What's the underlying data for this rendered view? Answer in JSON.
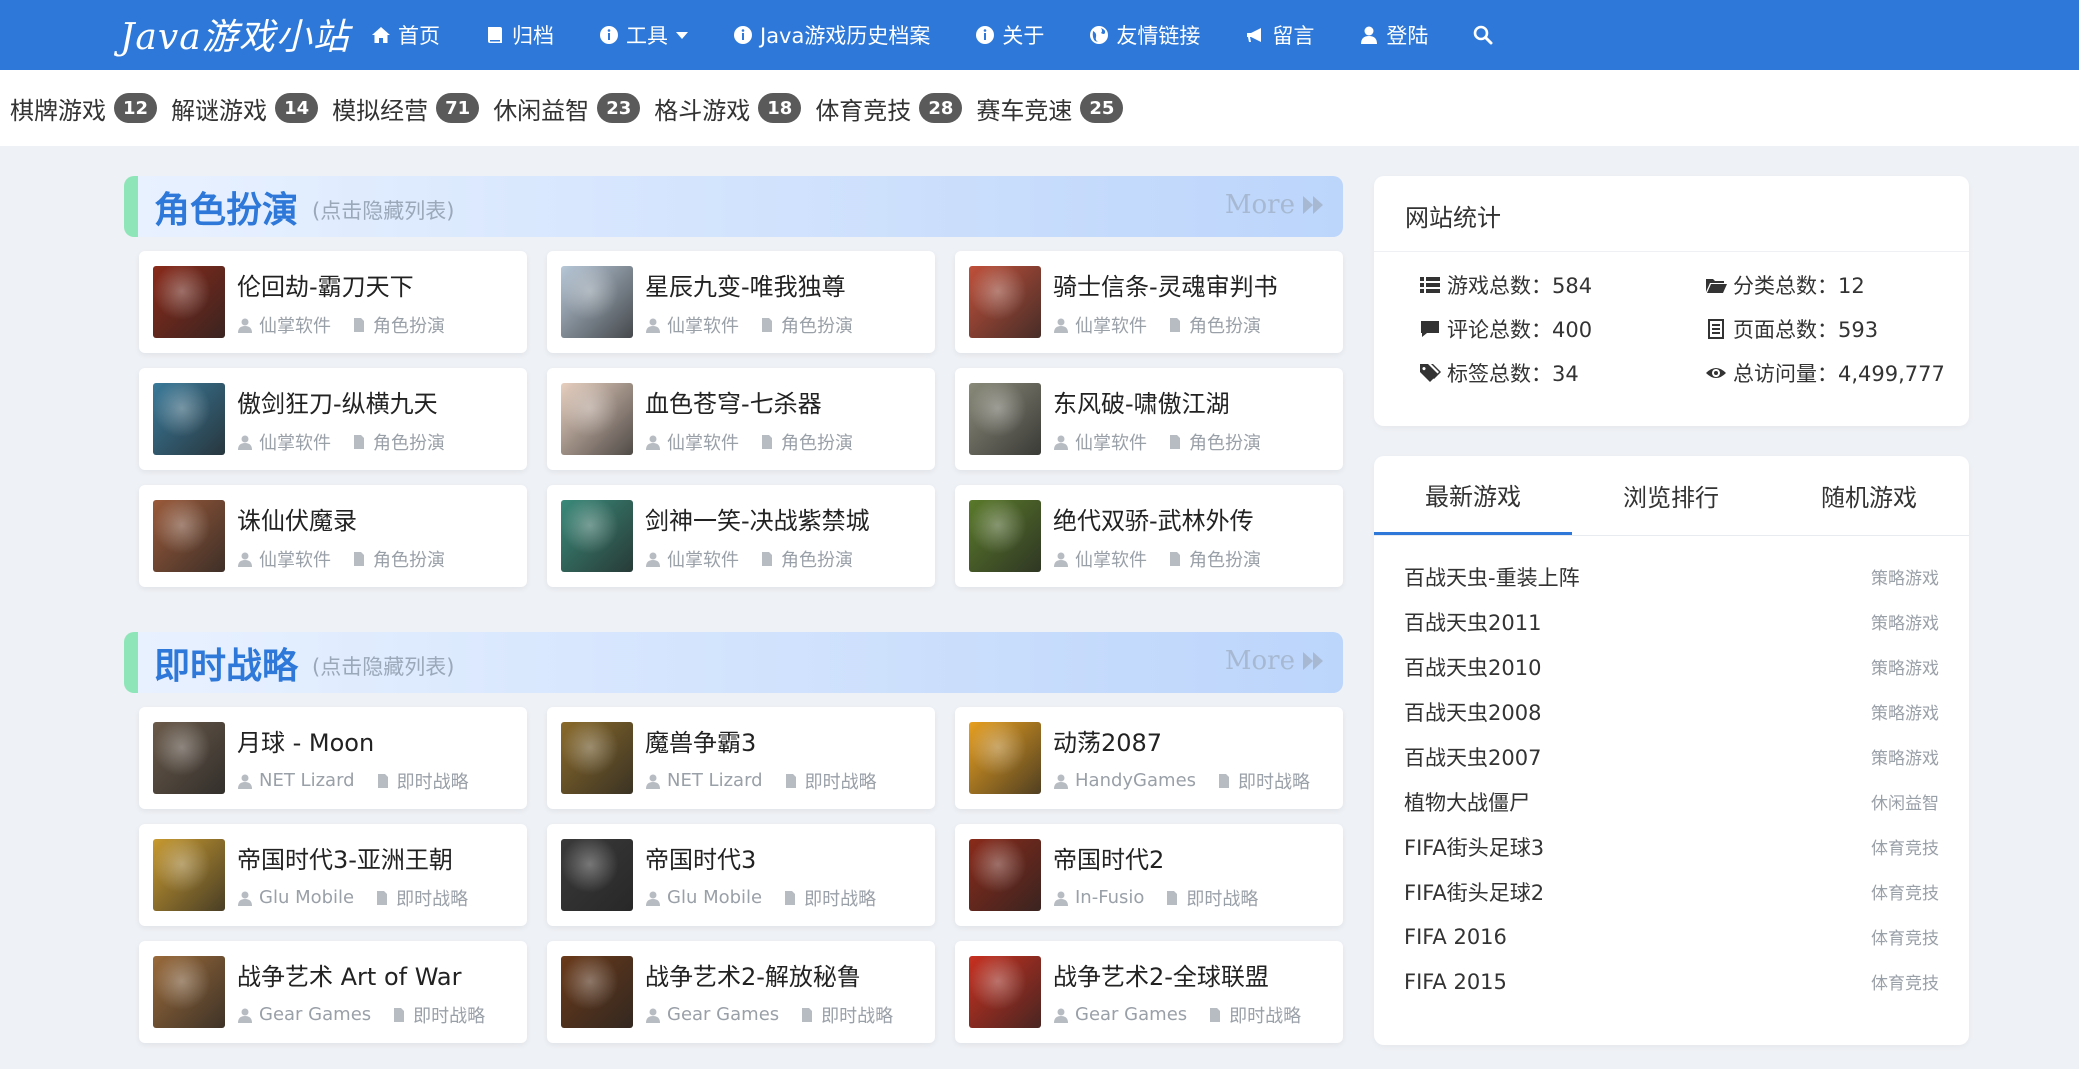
{
  "nav": {
    "brand": "Java游戏小站",
    "items": [
      {
        "label": "首页",
        "icon": "home-icon"
      },
      {
        "label": "归档",
        "icon": "book-icon"
      },
      {
        "label": "工具",
        "icon": "info-icon",
        "dropdown": true
      },
      {
        "label": "Java游戏历史档案",
        "icon": "info-icon"
      },
      {
        "label": "关于",
        "icon": "info-icon"
      },
      {
        "label": "友情链接",
        "icon": "globe-icon"
      },
      {
        "label": "留言",
        "icon": "bullhorn-icon"
      },
      {
        "label": "登陆",
        "icon": "user-icon"
      }
    ],
    "search_icon": "search-icon"
  },
  "categories": [
    {
      "label": "棋牌游戏",
      "count": "12"
    },
    {
      "label": "解谜游戏",
      "count": "14"
    },
    {
      "label": "模拟经营",
      "count": "71"
    },
    {
      "label": "休闲益智",
      "count": "23"
    },
    {
      "label": "格斗游戏",
      "count": "18"
    },
    {
      "label": "体育竞技",
      "count": "28"
    },
    {
      "label": "赛车竞速",
      "count": "25"
    }
  ],
  "sections": [
    {
      "title": "角色扮演",
      "hint": "(点击隐藏列表)",
      "more": "More",
      "games": [
        {
          "title": "伦回劫-霸刀天下",
          "vendor": "仙掌软件",
          "category": "角色扮演",
          "thumb_color": "#8a2a1a"
        },
        {
          "title": "星辰九变-唯我独尊",
          "vendor": "仙掌软件",
          "category": "角色扮演",
          "thumb_color": "#b8c8d8"
        },
        {
          "title": "骑士信条-灵魂审判书",
          "vendor": "仙掌软件",
          "category": "角色扮演",
          "thumb_color": "#c0503a"
        },
        {
          "title": "傲剑狂刀-纵横九天",
          "vendor": "仙掌软件",
          "category": "角色扮演",
          "thumb_color": "#3a7a9a"
        },
        {
          "title": "血色苍穹-七杀器",
          "vendor": "仙掌软件",
          "category": "角色扮演",
          "thumb_color": "#e8d0c0"
        },
        {
          "title": "东风破-啸傲江湖",
          "vendor": "仙掌软件",
          "category": "角色扮演",
          "thumb_color": "#8a8a7a"
        },
        {
          "title": "诛仙伏魔录",
          "vendor": "仙掌软件",
          "category": "角色扮演",
          "thumb_color": "#9a5a3a"
        },
        {
          "title": "剑神一笑-决战紫禁城",
          "vendor": "仙掌软件",
          "category": "角色扮演",
          "thumb_color": "#3a8a7a"
        },
        {
          "title": "绝代双骄-武林外传",
          "vendor": "仙掌软件",
          "category": "角色扮演",
          "thumb_color": "#5a7a2a"
        }
      ]
    },
    {
      "title": "即时战略",
      "hint": "(点击隐藏列表)",
      "more": "More",
      "games": [
        {
          "title": "月球 - Moon",
          "vendor": "NET Lizard",
          "category": "即时战略",
          "thumb_color": "#6a5a4a"
        },
        {
          "title": "魔兽争霸3",
          "vendor": "NET Lizard",
          "category": "即时战略",
          "thumb_color": "#8a6a2a"
        },
        {
          "title": "动荡2087",
          "vendor": "HandyGames",
          "category": "即时战略",
          "thumb_color": "#e8a020"
        },
        {
          "title": "帝国时代3-亚洲王朝",
          "vendor": "Glu Mobile",
          "category": "即时战略",
          "thumb_color": "#c89a30"
        },
        {
          "title": "帝国时代3",
          "vendor": "Glu Mobile",
          "category": "即时战略",
          "thumb_color": "#3a3a3a"
        },
        {
          "title": "帝国时代2",
          "vendor": "In-Fusio",
          "category": "即时战略",
          "thumb_color": "#8a2a1a"
        },
        {
          "title": "战争艺术 Art of War",
          "vendor": "Gear Games",
          "category": "即时战略",
          "thumb_color": "#9a6a3a"
        },
        {
          "title": "战争艺术2-解放秘鲁",
          "vendor": "Gear Games",
          "category": "即时战略",
          "thumb_color": "#6a3a1a"
        },
        {
          "title": "战争艺术2-全球联盟",
          "vendor": "Gear Games",
          "category": "即时战略",
          "thumb_color": "#c83020"
        }
      ]
    }
  ],
  "stats_panel": {
    "title": "网站统计",
    "items": [
      {
        "label": "游戏总数：584",
        "icon": "list-icon"
      },
      {
        "label": "分类总数：12",
        "icon": "folder-icon"
      },
      {
        "label": "评论总数：400",
        "icon": "comment-icon"
      },
      {
        "label": "页面总数：593",
        "icon": "page-icon"
      },
      {
        "label": "标签总数：34",
        "icon": "tags-icon"
      },
      {
        "label": "总访问量：4,499,777",
        "icon": "eye-icon"
      }
    ]
  },
  "list_panel": {
    "tabs": [
      "最新游戏",
      "浏览排行",
      "随机游戏"
    ],
    "active_tab": 0,
    "items": [
      {
        "name": "百战天虫-重装上阵",
        "category": "策略游戏"
      },
      {
        "name": "百战天虫2011",
        "category": "策略游戏"
      },
      {
        "name": "百战天虫2010",
        "category": "策略游戏"
      },
      {
        "name": "百战天虫2008",
        "category": "策略游戏"
      },
      {
        "name": "百战天虫2007",
        "category": "策略游戏"
      },
      {
        "name": "植物大战僵尸",
        "category": "休闲益智"
      },
      {
        "name": "FIFA街头足球3",
        "category": "体育竞技"
      },
      {
        "name": "FIFA街头足球2",
        "category": "体育竞技"
      },
      {
        "name": "FIFA 2016",
        "category": "体育竞技"
      },
      {
        "name": "FIFA 2015",
        "category": "体育竞技"
      }
    ]
  },
  "colors": {
    "nav": "#2d78d8",
    "accent": "#2d78d8",
    "section_bar": "#8ee6b8",
    "badge": "#5a5a5a"
  }
}
